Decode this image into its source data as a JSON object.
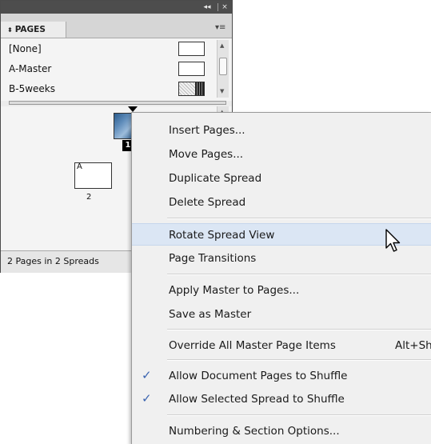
{
  "panel": {
    "collapse_glyph": "◂◂",
    "close_glyph": "×",
    "tab_label": "PAGES",
    "tab_arrow": "⬍",
    "menu_glyph": "▾≡",
    "masters": [
      {
        "label": "[None]",
        "thumb": "blank"
      },
      {
        "label": "A-Master",
        "thumb": "blank"
      },
      {
        "label": "B-5weeks",
        "thumb": "textured"
      }
    ],
    "pages": [
      {
        "number": "1",
        "master_label": "",
        "selected": true
      },
      {
        "number": "2",
        "master_label": "A",
        "selected": false
      }
    ],
    "status": "2 Pages in 2 Spreads"
  },
  "context_menu": {
    "groups": [
      [
        {
          "label": "Insert Pages..."
        },
        {
          "label": "Move Pages..."
        },
        {
          "label": "Duplicate Spread"
        },
        {
          "label": "Delete Spread"
        }
      ],
      [
        {
          "label": "Rotate Spread View",
          "highlighted": true
        },
        {
          "label": "Page Transitions"
        }
      ],
      [
        {
          "label": "Apply Master to Pages..."
        },
        {
          "label": "Save as Master"
        }
      ],
      [
        {
          "label": "Override All Master Page Items",
          "shortcut": "Alt+Sh"
        }
      ],
      [
        {
          "label": "Allow Document Pages to Shuffle",
          "checked": true
        },
        {
          "label": "Allow Selected Spread to Shuffle",
          "checked": true
        }
      ],
      [
        {
          "label": "Numbering & Section Options..."
        }
      ]
    ],
    "check_glyph": "✓"
  },
  "colors": {
    "titlebar": "#4d4d4d",
    "panel_bg": "#ececec",
    "menu_bg": "#f0f0f0",
    "menu_highlight": "#dbe6f4",
    "check": "#3a63b0"
  }
}
